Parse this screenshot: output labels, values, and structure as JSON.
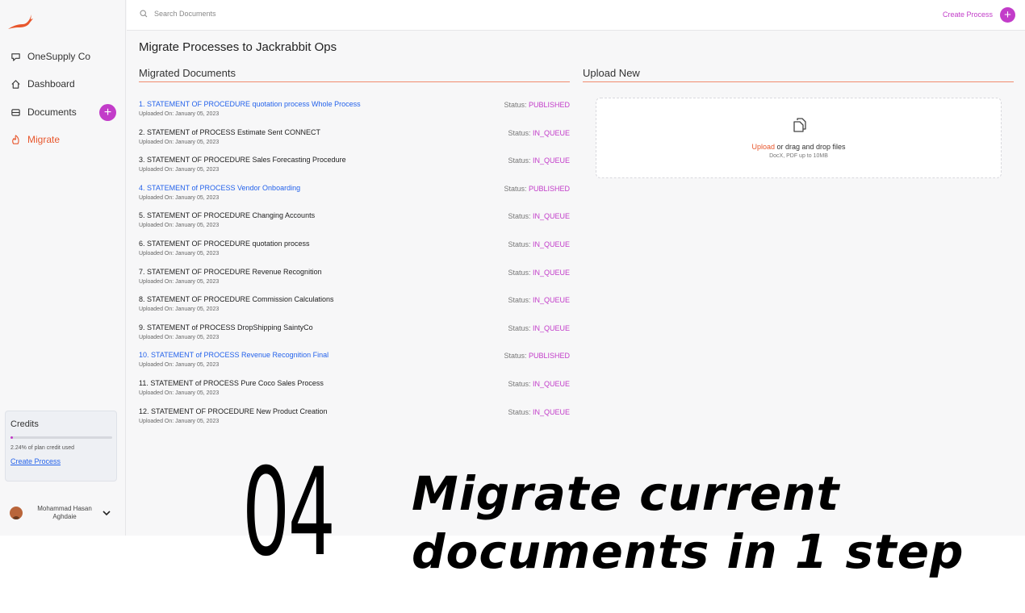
{
  "colors": {
    "accent": "#e8572d",
    "brand": "#c23cc9",
    "link": "#2563eb"
  },
  "sidebar": {
    "logo": "jackrabbit-logo",
    "items": [
      {
        "label": "OneSupply Co",
        "icon": "chat-icon",
        "active": false
      },
      {
        "label": "Dashboard",
        "icon": "home-icon",
        "active": false
      },
      {
        "label": "Documents",
        "icon": "inbox-icon",
        "active": false
      },
      {
        "label": "Migrate",
        "icon": "migrate-icon",
        "active": true
      }
    ],
    "add_button_label": "+",
    "credits": {
      "title": "Credits",
      "used_fraction": 0.0224,
      "used_text": "2.24% of plan credit used",
      "link": "Create Process"
    },
    "user": {
      "name": "Mohammad Hasan Aghdaie"
    }
  },
  "topbar": {
    "search_placeholder": "Search Documents",
    "create_label": "Create Process",
    "create_plus": "+"
  },
  "main": {
    "title": "Migrate Processes to Jackrabbit Ops",
    "migrated_title": "Migrated Documents",
    "upload_title": "Upload New",
    "status_prefix": "Status: ",
    "documents": [
      {
        "name": "1. STATEMENT OF PROCEDURE quotation process Whole Process",
        "date": "Uploaded On: January 05, 2023",
        "status": "PUBLISHED"
      },
      {
        "name": "2. STATEMENT of PROCESS Estimate Sent CONNECT",
        "date": "Uploaded On: January 05, 2023",
        "status": "IN_QUEUE"
      },
      {
        "name": "3. STATEMENT OF PROCEDURE Sales Forecasting Procedure",
        "date": "Uploaded On: January 05, 2023",
        "status": "IN_QUEUE"
      },
      {
        "name": "4. STATEMENT of PROCESS Vendor Onboarding",
        "date": "Uploaded On: January 05, 2023",
        "status": "PUBLISHED"
      },
      {
        "name": "5. STATEMENT OF PROCEDURE Changing Accounts",
        "date": "Uploaded On: January 05, 2023",
        "status": "IN_QUEUE"
      },
      {
        "name": "6. STATEMENT OF PROCEDURE quotation process",
        "date": "Uploaded On: January 05, 2023",
        "status": "IN_QUEUE"
      },
      {
        "name": "7. STATEMENT OF PROCEDURE Revenue Recognition",
        "date": "Uploaded On: January 05, 2023",
        "status": "IN_QUEUE"
      },
      {
        "name": "8. STATEMENT OF PROCEDURE Commission Calculations",
        "date": "Uploaded On: January 05, 2023",
        "status": "IN_QUEUE"
      },
      {
        "name": "9. STATEMENT of PROCESS DropShipping SaintyCo",
        "date": "Uploaded On: January 05, 2023",
        "status": "IN_QUEUE"
      },
      {
        "name": "10. STATEMENT of PROCESS Revenue Recognition Final",
        "date": "Uploaded On: January 05, 2023",
        "status": "PUBLISHED"
      },
      {
        "name": "11. STATEMENT of PROCESS Pure Coco Sales Process",
        "date": "Uploaded On: January 05, 2023",
        "status": "IN_QUEUE"
      },
      {
        "name": "12. STATEMENT OF PROCEDURE New Product Creation",
        "date": "Uploaded On: January 05, 2023",
        "status": "IN_QUEUE"
      }
    ],
    "upload": {
      "icon": "copy-file-icon",
      "link": "Upload",
      "text": " or drag and drop files",
      "hint": "DocX, PDF up to 10MB"
    }
  },
  "overlay": {
    "number": "04",
    "line1": "Migrate current",
    "line2": "documents in 1 step"
  }
}
